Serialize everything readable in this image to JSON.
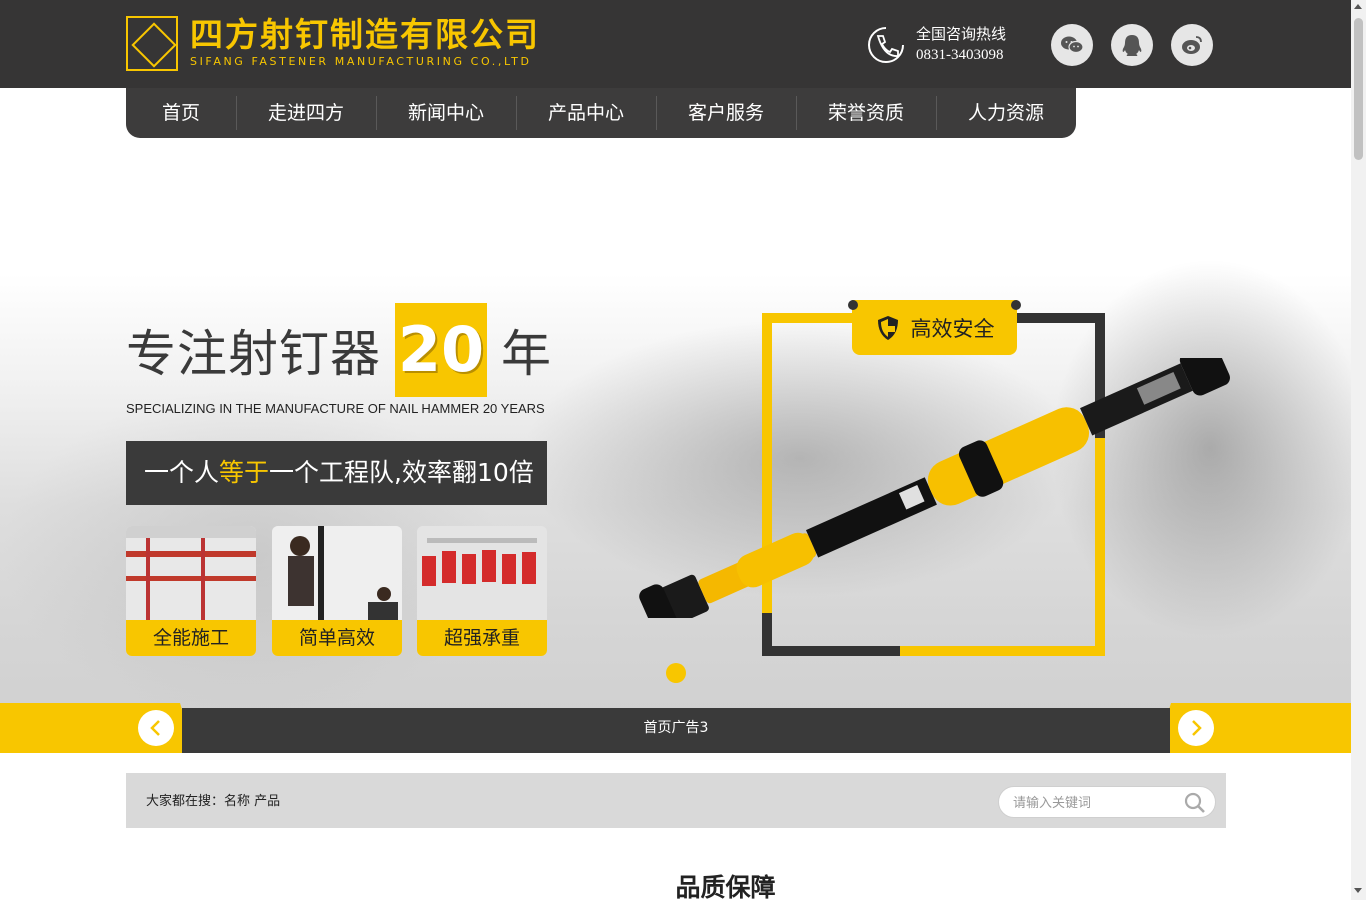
{
  "header": {
    "company_cn": "四方射钉制造有限公司",
    "company_en": "SIFANG FASTENER MANUFACTURING CO.,LTD",
    "hotline_label": "全国咨询热线",
    "hotline_number": "0831-3403098",
    "social_icons": [
      "wechat-icon",
      "qq-icon",
      "weibo-icon"
    ]
  },
  "nav": {
    "items": [
      {
        "label": "首页"
      },
      {
        "label": "走进四方"
      },
      {
        "label": "新闻中心"
      },
      {
        "label": "产品中心"
      },
      {
        "label": "客户服务"
      },
      {
        "label": "荣誉资质"
      },
      {
        "label": "人力资源"
      }
    ]
  },
  "banner": {
    "headline_prefix": "专注射钉器",
    "headline_number": "20",
    "headline_suffix": "年",
    "subline": "SPECIALIZING IN THE MANUFACTURE OF NAIL HAMMER 20 YEARS",
    "slogan_part1": "一个人",
    "slogan_highlight": "等于",
    "slogan_part2": "一个工程队,效率翻10倍",
    "features": [
      {
        "caption": "全能施工"
      },
      {
        "caption": "简单高效"
      },
      {
        "caption": "超强承重"
      }
    ],
    "safety_label": "高效安全",
    "caption": "首页广告3",
    "active_slide": 1
  },
  "search": {
    "hot_label": "大家都在搜：名称 产品",
    "placeholder": "请输入关键词"
  },
  "section": {
    "title": "品质保障"
  },
  "colors": {
    "accent": "#f8c600",
    "dark": "#363535"
  }
}
